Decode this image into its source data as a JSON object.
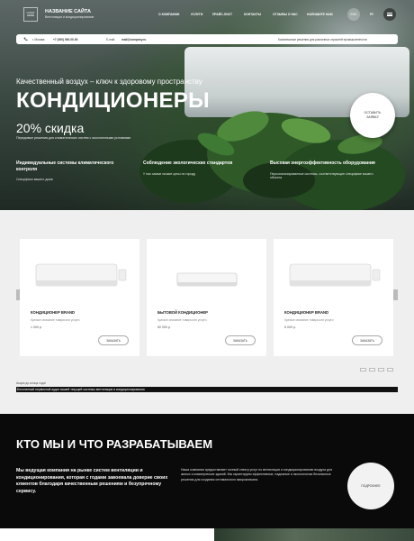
{
  "header": {
    "logo_text": "LOGO\nHERE",
    "site_name": "НАЗВАНИЕ САЙТА",
    "site_subtitle": "Вентиляция и кондиционирование",
    "nav": [
      "О КОМПАНИИ",
      "УСЛУГИ",
      "ПРАЙС-ЛИСТ",
      "КОНТАКТЫ",
      "ОТЗЫВЫ О НАС",
      "НАПИШИТЕ НАМ"
    ],
    "eng_label": "ENG",
    "lang_label": "РУ"
  },
  "contact_bar": {
    "city": "г. Москва",
    "phone": "+7 (000) 000-00-00",
    "email_label": "E-mail:",
    "email": "mail@company.ru",
    "tagline": "Комплексные решения для различных отраслей промышленности"
  },
  "hero": {
    "kicker": "Качественный воздух – ключ к здоровому пространству",
    "title": "КОНДИЦИОНЕРЫ",
    "discount": "20% скидка",
    "description": "Передовые решения для климатических систем с экологичными условиями",
    "leave_request": "ОСТАВИТЬ\nЗАЯВКУ"
  },
  "features": [
    {
      "title": "Индивидуальные системы климатического контроля",
      "desc": "Специфика вашего дома"
    },
    {
      "title": "Соблюдение экологических стандартов",
      "desc": "У нас самые низкие цены по городу"
    },
    {
      "title": "Высокая энергоэффективность оборудования",
      "desc": "Персонализированные системы, соответствующие специфике вашего объекта"
    }
  ],
  "products": [
    {
      "name": "КОНДИЦИОНЕР BRAND",
      "desc": "Краткое описание товара или услуги",
      "price": "1 000 р.",
      "order": "ЗАКАЗАТЬ"
    },
    {
      "name": "БЫТОВОЙ КОНДИЦИОНЕР",
      "desc": "Краткое описание товара или услуги",
      "price": "60 000 р.",
      "order": "ЗАКАЗАТЬ"
    },
    {
      "name": "КОНДИЦИОНЕР BRAND",
      "desc": "Краткое описание товара или услуги",
      "price": "6 000 р.",
      "order": "ЗАКАЗАТЬ"
    }
  ],
  "promo": {
    "small": "Акция до конца года!",
    "bar": "Бесплатный первичный аудит вашей текущей системы вентиляции и кондиционирования"
  },
  "about": {
    "title": "КТО МЫ И ЧТО РАЗРАБАТЫВАЕМ",
    "lead": "Мы ведущая компания на рынке систем вентиляции и кондиционирования, которая с годами завоевала доверие своих клиентов благодаря качественным решениям и безупречному сервису.",
    "text": "Наша компания предоставляет полный спектр услуг по вентиляции и кондиционированию воздуха для жилых и коммерческих зданий. Мы гарантируем эффективные, надежные и экологически безопасные решения для создания оптимального микроклимата.",
    "more": "ПОДРОБНЕЕ"
  },
  "colors": {
    "dark": "#0a0a0a",
    "light_bg": "#efefef",
    "accent": "#ffffff"
  }
}
